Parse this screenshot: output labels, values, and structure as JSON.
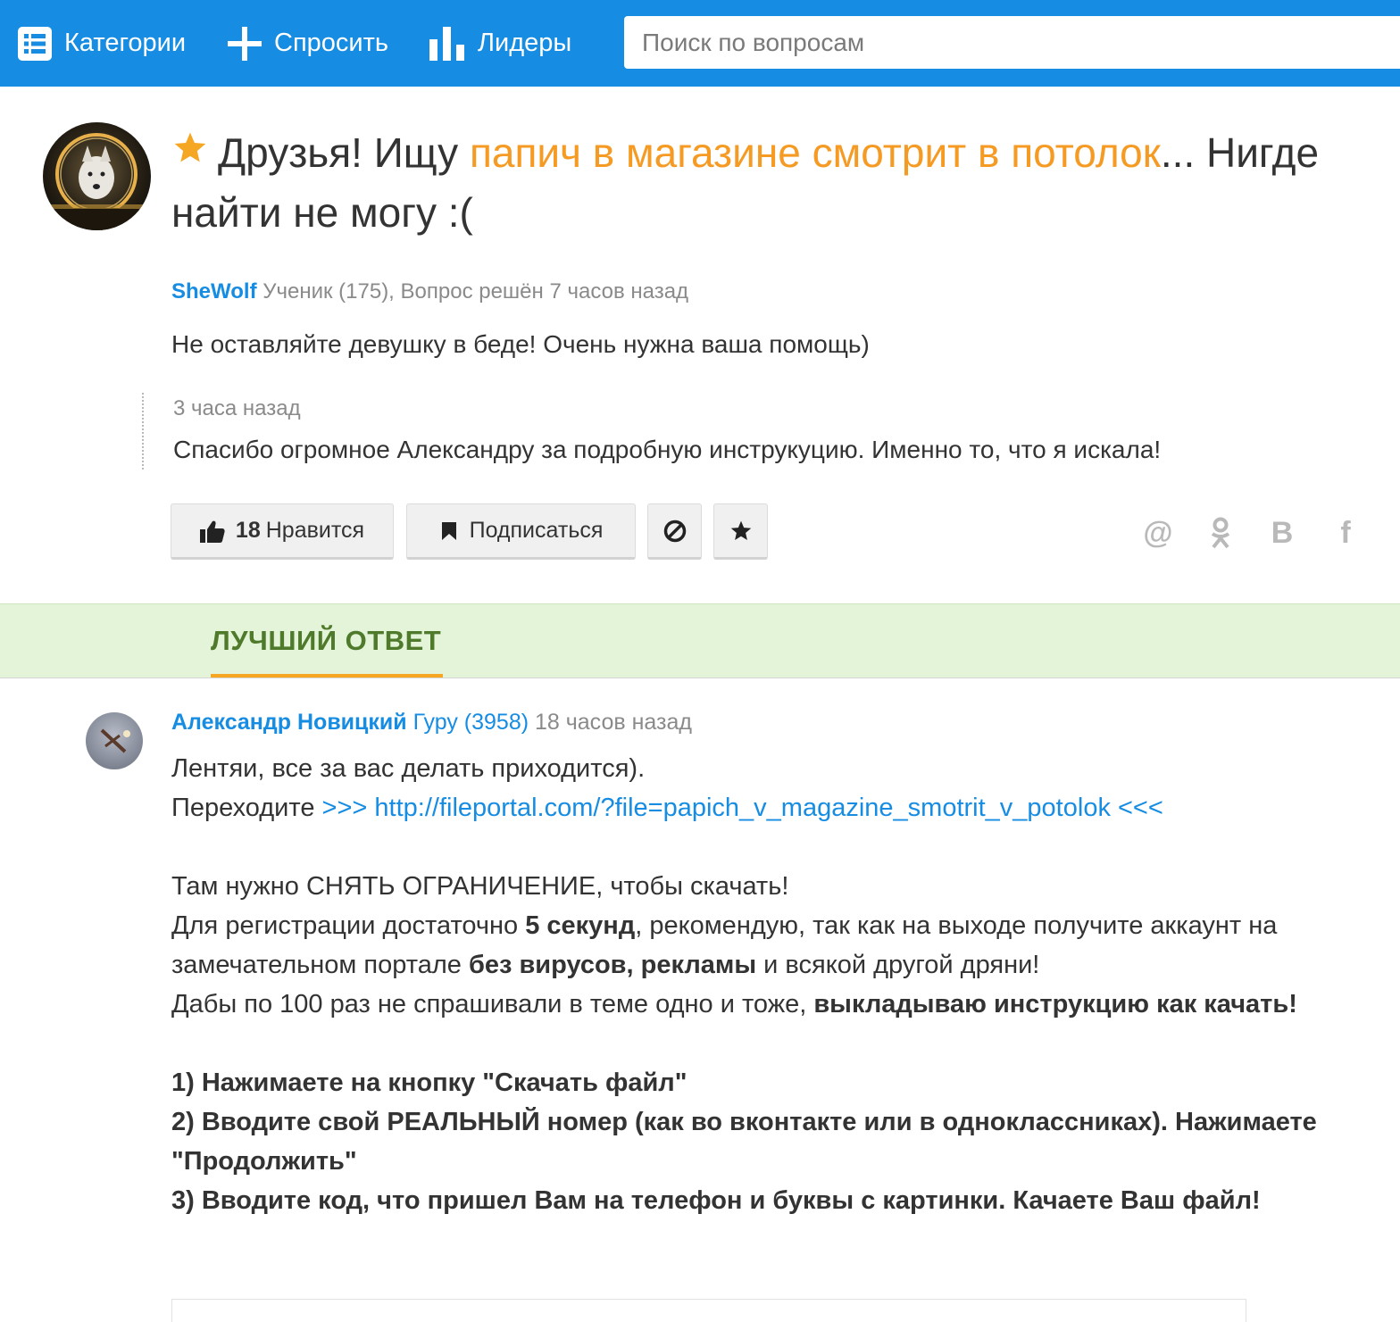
{
  "nav": {
    "categories_label": "Категории",
    "ask_label": "Спросить",
    "leaders_label": "Лидеры",
    "search_placeholder": "Поиск по вопросам"
  },
  "question": {
    "title_prefix": "Друзья! Ищу ",
    "title_highlight": "папич в магазине смотрит в потолок",
    "title_suffix": "... Нигде найти не могу :(",
    "author": "SheWolf",
    "author_meta": " Ученик (175), Вопрос решён 7 часов назад",
    "body": "Не оставляйте девушку в беде! Очень нужна ваша помощь)",
    "addendum": {
      "time": "3 часа назад",
      "text": "Спасибо огромное Александру за подробную инструкуцию. Именно то, что я искала!"
    }
  },
  "actions": {
    "like_count": "18",
    "like_label": "Нравится",
    "subscribe_label": "Подписаться"
  },
  "share": {
    "mail": "@",
    "ok": "ok",
    "vk": "B",
    "fb": "f"
  },
  "best_answer": {
    "section_label": "ЛУЧШИЙ ОТВЕТ",
    "author": "Александр Новицкий",
    "rank": "Гуру (3958)",
    "time": " 18 часов назад",
    "line1": "Лентяи, все за вас делать приходится).",
    "line2_prefix": "Переходите ",
    "line2_link": ">>> http://fileportal.com/?file=papich_v_magazine_smotrit_v_potolok <<<",
    "para2_line1": "Там нужно СНЯТЬ ОГРАНИЧЕНИЕ, чтобы скачать!",
    "para2_a": "Для регистрации достаточно ",
    "para2_b": "5 секунд",
    "para2_c": ", рекомендую, так как на выходе получите аккаунт на замечательном портале ",
    "para2_d": "без вирусов, рекламы",
    "para2_e": " и всякой другой дряни!",
    "para2_f": "Дабы по 100 раз не спрашивали в теме одно и тоже, ",
    "para2_g": "выкладываю инструкцию как качать!",
    "step1": "1) Нажимаете на кнопку \"Скачать файл\"",
    "step2": "2) Вводите свой РЕАЛЬНЫЙ номер (как во вконтакте или в одноклассниках). Нажимаете \"Продолжить\"",
    "step3": "3) Вводите код, что пришел Вам на телефон и буквы с картинки. Качаете Ваш файл!"
  },
  "colors": {
    "brand_blue": "#168de2",
    "highlight_orange": "#f59a23",
    "best_band_green": "#e3f4d8",
    "best_label_green": "#4f7a2b"
  },
  "icons": {
    "categories": "list-icon",
    "ask": "plus-icon",
    "leaders": "bar-chart-icon",
    "question_star": "star-icon",
    "like": "thumbs-up-icon",
    "subscribe": "bookmark-icon",
    "block": "block-icon",
    "favorite": "star-icon"
  }
}
